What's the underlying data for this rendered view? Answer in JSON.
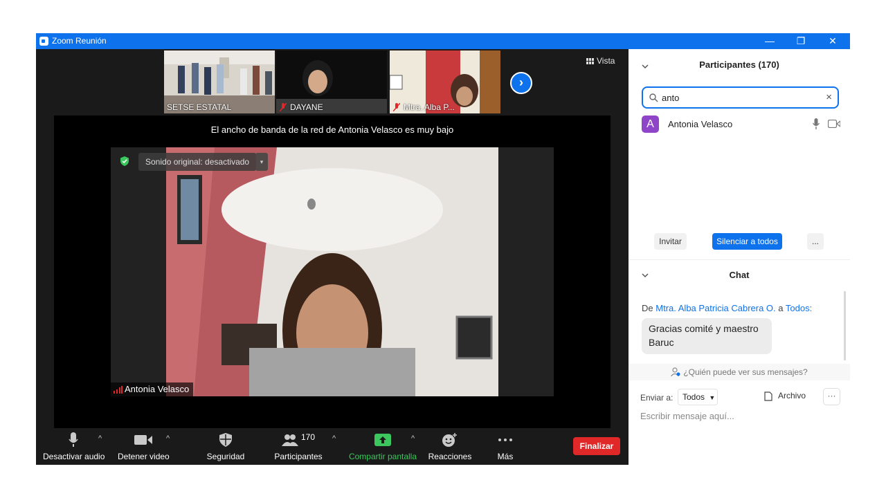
{
  "window": {
    "title": "Zoom Reunión",
    "controls": {
      "minimize": "—",
      "restore": "❐",
      "close": "✕"
    }
  },
  "meeting": {
    "view_label": "Vista",
    "thumbnails": [
      {
        "name": "SETSE ESTATAL",
        "muted": false
      },
      {
        "name": "DAYANE",
        "muted": true
      },
      {
        "name": "Mtra. Alba P...",
        "muted": true
      }
    ],
    "next_page_icon": "chevron-right-icon",
    "bandwidth_warning": "El ancho de banda de la red de Antonia Velasco es muy bajo",
    "sound_label": "Sonido original: desactivado",
    "speaker_name": "Antonia Velasco"
  },
  "toolbar": {
    "audio_label": "Desactivar audio",
    "video_label": "Detener video",
    "security_label": "Seguridad",
    "participants_label": "Participantes",
    "participants_count": "170",
    "share_label": "Compartir pantalla",
    "reactions_label": "Reacciones",
    "more_label": "Más",
    "end_label": "Finalizar",
    "colors": {
      "share_green": "#3bc75d",
      "end_red": "#e02828"
    }
  },
  "participants_panel": {
    "title": "Participantes (170)",
    "search_value": "anto",
    "participant": {
      "initial": "A",
      "name": "Antonia Velasco",
      "avatar_color": "#8f45c8"
    },
    "invite_label": "Invitar",
    "mute_all_label": "Silenciar a todos",
    "more_label": "..."
  },
  "chat": {
    "title": "Chat",
    "message": {
      "prefix": "De",
      "sender": "Mtra. Alba Patricia Cabrera O.",
      "connector": "a",
      "recipient": "Todos:",
      "text": "Gracias comité y maestro Baruc"
    },
    "who_can_see": "¿Quién puede ver sus mensajes?",
    "send_to_label": "Enviar a:",
    "send_to_value": "Todos",
    "file_label": "Archivo",
    "more_label": "···",
    "input_placeholder": "Escribir mensaje aquí..."
  }
}
